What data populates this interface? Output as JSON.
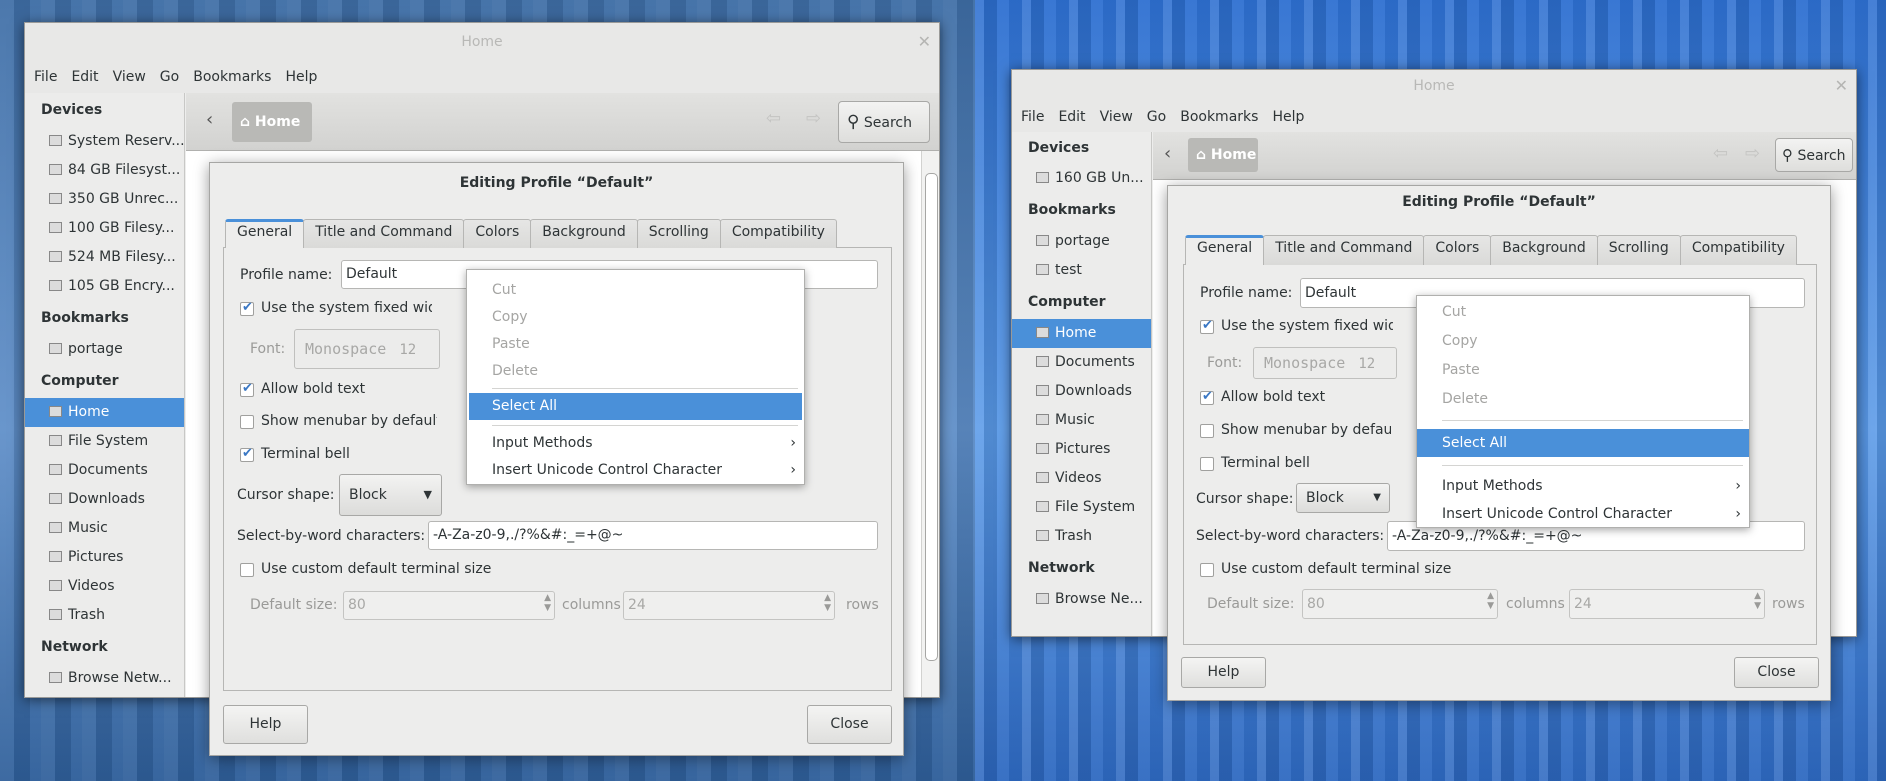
{
  "window_left": {
    "title": "Home",
    "menu": [
      "File",
      "Edit",
      "View",
      "Go",
      "Bookmarks",
      "Help"
    ],
    "sidebar": {
      "devices_header": "Devices",
      "devices": [
        "System Reserv...",
        "84 GB Filesyst...",
        "350 GB Unrec...",
        "100 GB Filesy...",
        "524 MB Filesy...",
        "105 GB Encry..."
      ],
      "bookmarks_header": "Bookmarks",
      "bookmarks": [
        "portage"
      ],
      "computer_header": "Computer",
      "computer": [
        "Home",
        "File System",
        "Documents",
        "Downloads",
        "Music",
        "Pictures",
        "Videos",
        "Trash"
      ],
      "network_header": "Network",
      "network": [
        "Browse Netw..."
      ]
    },
    "toolbar": {
      "path": "Home",
      "search": "Search"
    }
  },
  "window_right": {
    "title": "Home",
    "menu": [
      "File",
      "Edit",
      "View",
      "Go",
      "Bookmarks",
      "Help"
    ],
    "sidebar": {
      "devices_header": "Devices",
      "devices": [
        "160 GB Un..."
      ],
      "bookmarks_header": "Bookmarks",
      "bookmarks": [
        "portage",
        "test"
      ],
      "computer_header": "Computer",
      "computer": [
        "Home",
        "Documents",
        "Downloads",
        "Music",
        "Pictures",
        "Videos",
        "File System",
        "Trash"
      ],
      "network_header": "Network",
      "network": [
        "Browse Ne..."
      ]
    },
    "toolbar": {
      "path": "Home",
      "search": "Search"
    }
  },
  "dialog": {
    "title": "Editing Profile “Default”",
    "tabs": [
      "General",
      "Title and Command",
      "Colors",
      "Background",
      "Scrolling",
      "Compatibility"
    ],
    "profile_name_label": "Profile name:",
    "profile_name_value": "Default",
    "use_system_font": "Use the system fixed width font",
    "font_label": "Font:",
    "font_value": "Monospace",
    "font_size": "12",
    "allow_bold": "Allow bold text",
    "show_menubar": "Show menubar by default in new terminals",
    "terminal_bell": "Terminal bell",
    "cursor_shape_label": "Cursor shape:",
    "cursor_shape_value": "Block",
    "select_by_word_label": "Select-by-word characters:",
    "select_by_word_value": "-A-Za-z0-9,./?%&#:_=+@~",
    "custom_size": "Use custom default terminal size",
    "default_size_label": "Default size:",
    "columns_value": "80",
    "columns_label": "columns",
    "rows_value": "24",
    "rows_label": "rows",
    "help": "Help",
    "close": "Close"
  },
  "context_menu": {
    "cut": "Cut",
    "copy": "Copy",
    "paste": "Paste",
    "delete": "Delete",
    "select_all": "Select All",
    "input_methods": "Input Methods",
    "insert_unicode": "Insert Unicode Control Character"
  },
  "colors": {
    "accent": "#4a90d9"
  }
}
